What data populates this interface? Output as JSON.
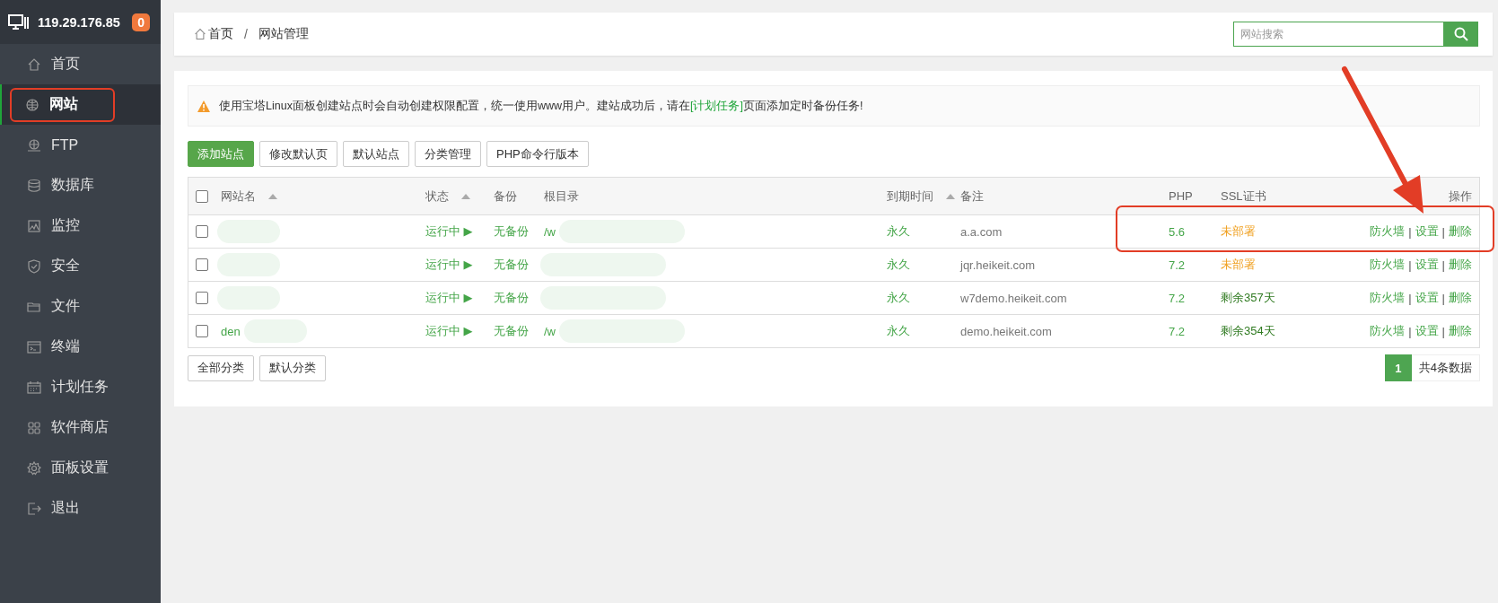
{
  "sidebar": {
    "server": "119.29.176.85",
    "badge": "0",
    "items": [
      {
        "label": "首页",
        "selected": false,
        "annotated": false
      },
      {
        "label": "网站",
        "selected": true,
        "annotated": true
      },
      {
        "label": "FTP",
        "selected": false,
        "annotated": false
      },
      {
        "label": "数据库",
        "selected": false,
        "annotated": false
      },
      {
        "label": "监控",
        "selected": false,
        "annotated": false
      },
      {
        "label": "安全",
        "selected": false,
        "annotated": false
      },
      {
        "label": "文件",
        "selected": false,
        "annotated": false
      },
      {
        "label": "终端",
        "selected": false,
        "annotated": false
      },
      {
        "label": "计划任务",
        "selected": false,
        "annotated": false
      },
      {
        "label": "软件商店",
        "selected": false,
        "annotated": false
      },
      {
        "label": "面板设置",
        "selected": false,
        "annotated": false
      },
      {
        "label": "退出",
        "selected": false,
        "annotated": false
      }
    ]
  },
  "breadcrumb": {
    "items": [
      "首页",
      "网站管理"
    ],
    "separator": "/"
  },
  "search": {
    "placeholder": "网站搜索"
  },
  "alert": {
    "before": "使用宝塔Linux面板创建站点时会自动创建权限配置，统一使用www用户。建站成功后，请在",
    "link": "[计划任务]",
    "after": "页面添加定时备份任务!"
  },
  "toolbar": [
    {
      "label": "添加站点",
      "kind": "primary"
    },
    {
      "label": "修改默认页",
      "kind": "default"
    },
    {
      "label": "默认站点",
      "kind": "default"
    },
    {
      "label": "分类管理",
      "kind": "default"
    },
    {
      "label": "PHP命令行版本",
      "kind": "default"
    }
  ],
  "table": {
    "select_all": {
      "checked": false
    },
    "columns": [
      {
        "label": "网站名",
        "sortable": true
      },
      {
        "label": "状态",
        "sortable": true
      },
      {
        "label": "备份",
        "sortable": false
      },
      {
        "label": "根目录",
        "sortable": false
      },
      {
        "label": "到期时间",
        "sortable": true
      },
      {
        "label": "备注",
        "sortable": false
      },
      {
        "label": "PHP",
        "sortable": false
      },
      {
        "label": "SSL证书",
        "sortable": false
      },
      {
        "label": "操作",
        "sortable": false
      }
    ],
    "action_separator": "|",
    "rows": [
      {
        "checked": false,
        "name_redacted": true,
        "status": "运行中 ▶",
        "backup": "无备份",
        "root": "/w",
        "root_redacted": true,
        "expiry": "永久",
        "note": "a.a.com",
        "php": "5.6",
        "ssl": "未部署",
        "ssl_deployed": false,
        "actions": [
          "防火墙",
          "设置",
          "删除"
        ]
      },
      {
        "checked": false,
        "name_redacted": true,
        "status": "运行中 ▶",
        "backup": "无备份",
        "root_redacted": true,
        "expiry": "永久",
        "note": "jqr.heikeit.com",
        "php": "7.2",
        "ssl": "未部署",
        "ssl_deployed": false,
        "actions": [
          "防火墙",
          "设置",
          "删除"
        ]
      },
      {
        "checked": false,
        "name_redacted": true,
        "status": "运行中 ▶",
        "backup": "无备份",
        "root_redacted": true,
        "expiry": "永久",
        "note": "w7demo.heikeit.com",
        "php": "7.2",
        "ssl": "剩余357天",
        "ssl_deployed": true,
        "actions": [
          "防火墙",
          "设置",
          "删除"
        ]
      },
      {
        "checked": false,
        "name": "den",
        "name_redacted": true,
        "status": "运行中 ▶",
        "backup": "无备份",
        "root": "/w",
        "root_redacted": true,
        "expiry": "永久",
        "note": "demo.heikeit.com",
        "php": "7.2",
        "ssl": "剩余354天",
        "ssl_deployed": true,
        "actions": [
          "防火墙",
          "设置",
          "删除"
        ]
      }
    ]
  },
  "categories": [
    "全部分类",
    "默认分类"
  ],
  "pagination": {
    "pages": [
      {
        "label": "1",
        "selected": true
      }
    ],
    "total": "共4条数据"
  },
  "annotations": {
    "table_frame": true,
    "arrow": true
  }
}
